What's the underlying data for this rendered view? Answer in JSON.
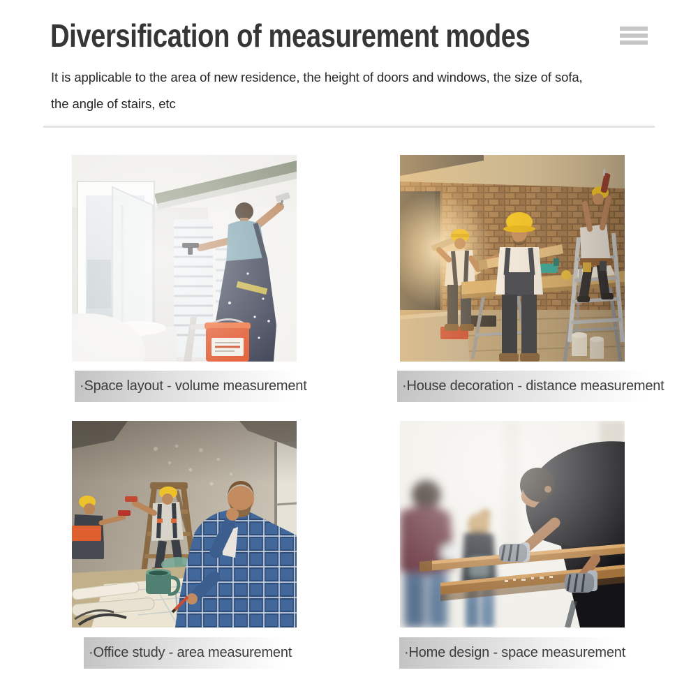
{
  "header": {
    "title": "Diversification of measurement modes",
    "subtitle_lines": [
      "It is applicable to the area of new residence, the height of doors and windows, the size of sofa,",
      "the angle of stairs, etc"
    ],
    "menu_icon": "hamburger-menu-icon"
  },
  "features": [
    {
      "caption": "·Space layout - volume measurement",
      "alt": "Painter in dark overalls and teal shirt plastering a ceiling beside open white windows, orange bucket on a ladder"
    },
    {
      "caption": "·House decoration - distance measurement",
      "alt": "Three workers in yellow hard hats renovating a sunlit brick-walled room, one on a ladder sealing the ceiling"
    },
    {
      "caption": "·Office study - area measurement",
      "alt": "Man in blue plaid shirt studying blueprints at a desk with a green mug while helmeted workers use a stepladder behind"
    },
    {
      "caption": "·Home design - space measurement",
      "alt": "Man in black t-shirt and striped work gloves leaning over wooden planks, blurred couple in the background"
    }
  ],
  "colors": {
    "background": "#ffffff",
    "title_text": "#363636",
    "body_text": "#262626",
    "caption_text": "#3d3d3d",
    "caption_bar": "#c3c3c3",
    "divider": "#e4e4e4",
    "menu_icon": "#c6c6c6",
    "accent_helmet_yellow": "#f0c21d",
    "accent_bucket_orange": "#e0552a"
  }
}
